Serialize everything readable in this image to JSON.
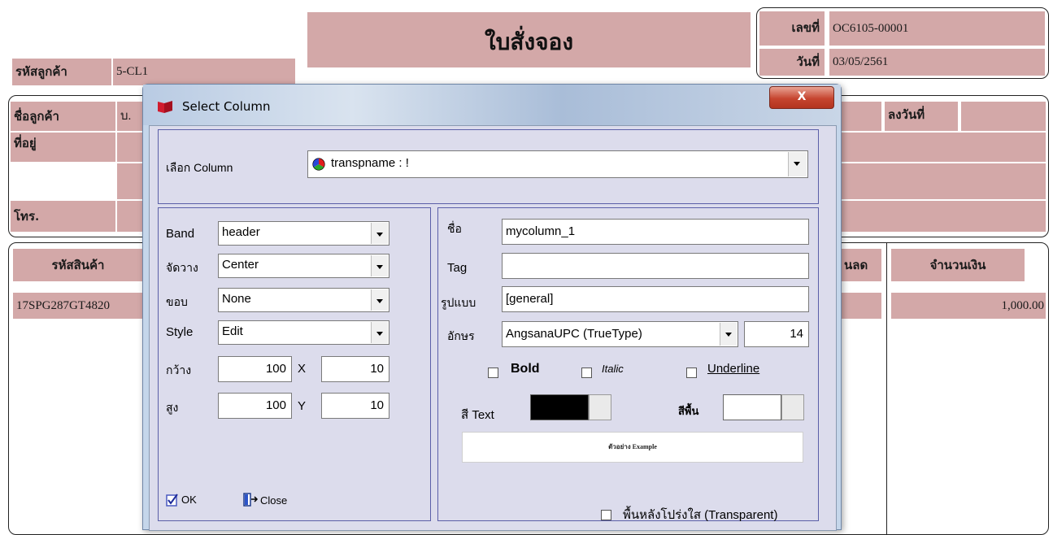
{
  "doc": {
    "title": "ใบสั่งจอง",
    "doc_no_label": "เลขที่",
    "doc_no_value": "OC6105-00001",
    "date_label": "วันที่",
    "date_value": "03/05/2561",
    "customer_code_label": "รหัสลูกค้า",
    "customer_code_value": "5-CL1",
    "customer_name_label": "ชื่อลูกค้า",
    "customer_name_value": "บ.",
    "address_label": "ที่อยู่",
    "phone_label": "โทร.",
    "sign_date_label": "ลงวันที่",
    "product_code_header": "รหัสสินค้า",
    "discount_header": "นลด",
    "amount_header": "จำนวนเงิน",
    "row_product_code": "17SPG287GT4820",
    "row_amount": "1,000.00"
  },
  "dialog": {
    "title": "Select Column",
    "close_label": "X",
    "select_column_label": "เลือก Column",
    "select_column_value": "transpname : !",
    "band_label": "Band",
    "band_value": "header",
    "align_label": "จัดวาง",
    "align_value": "Center",
    "border_label": "ขอบ",
    "border_value": "None",
    "style_label": "Style",
    "style_value": "Edit",
    "width_label": "กว้าง",
    "width_value": "100",
    "x_label": "X",
    "x_value": "10",
    "height_label": "สูง",
    "height_value": "100",
    "y_label": "Y",
    "y_value": "10",
    "name_label": "ชื่อ",
    "name_value": "mycolumn_1",
    "tag_label": "Tag",
    "tag_value": "",
    "format_label": "รูปแบบ",
    "format_value": "[general]",
    "font_label": "อักษร",
    "font_value": "AngsanaUPC (TrueType)",
    "font_size_value": "14",
    "bold_label": "Bold",
    "italic_label": "Italic",
    "underline_label": "Underline",
    "text_color_label": "สี Text",
    "text_color": "#000000",
    "bg_color_label": "สีพื้น",
    "bg_color": "#ffffff",
    "preview_text": "ตัวอย่าง Example",
    "ok_label": "OK",
    "close_button_label": "Close",
    "transparent_label": "พื้นหลังโปร่งใส (Transparent)"
  }
}
